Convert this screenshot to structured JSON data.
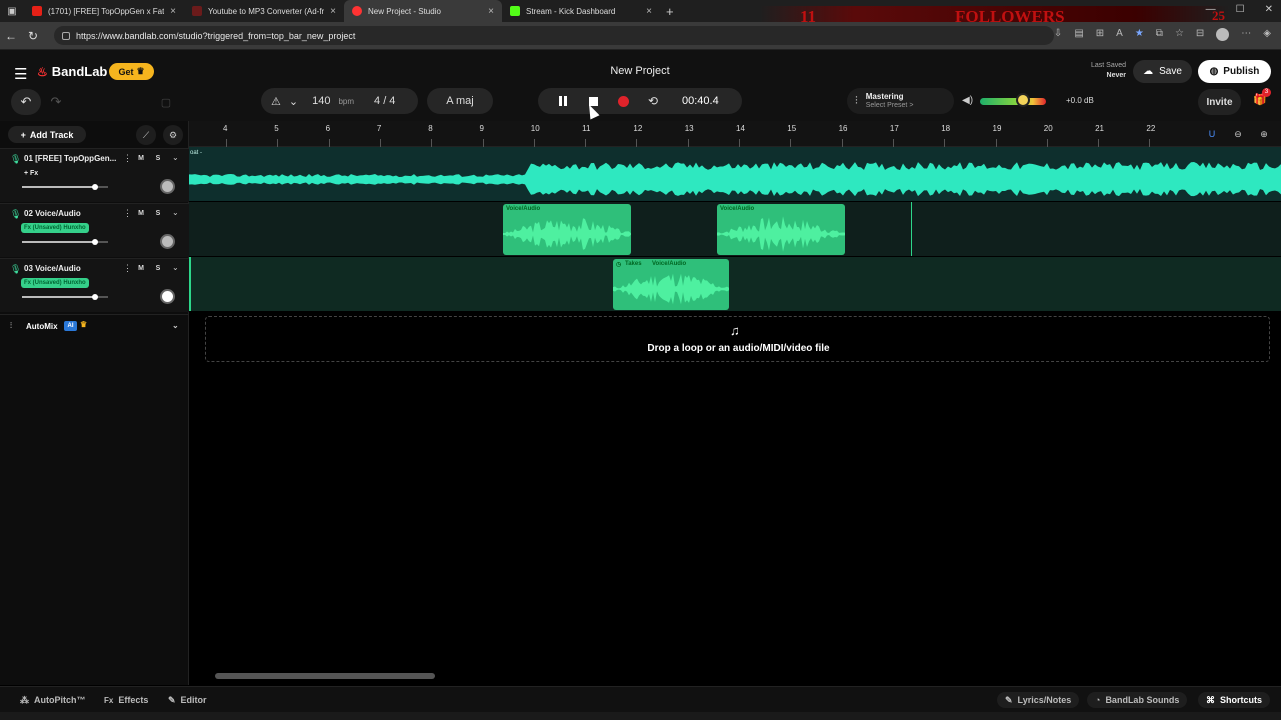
{
  "browser": {
    "tabs": [
      {
        "title": "(1701) [FREE] TopOppGen x Fatt!",
        "color": "#e62117",
        "active": false
      },
      {
        "title": "Youtube to MP3 Converter (Ad-fr",
        "color": "#cc3333",
        "active": false
      },
      {
        "title": "New Project - Studio",
        "color": "#f33",
        "active": true
      },
      {
        "title": "Stream - Kick Dashboard",
        "color": "#53fc18",
        "active": false
      }
    ],
    "url": "https://www.bandlab.com/studio?triggered_from=top_bar_new_project",
    "overlay": {
      "count_left": "11",
      "label": "FOLLOWERS",
      "count_right": "25"
    }
  },
  "header": {
    "logo": "BandLab",
    "get_label": "Get",
    "project_title": "New Project",
    "last_saved_label": "Last Saved",
    "last_saved_value": "Never",
    "save_label": "Save",
    "publish_label": "Publish",
    "invite_label": "Invite",
    "gift_badge": "3"
  },
  "transport": {
    "bpm_value": "140",
    "bpm_unit": "bpm",
    "time_signature": "4 / 4",
    "key": "A maj",
    "time": "00:40.4",
    "mastering_title": "Mastering",
    "mastering_sub": "Select Preset >",
    "volume_db": "+0.0 dB",
    "volume_level": 0.65
  },
  "left": {
    "add_track": "Add Track",
    "tracks": [
      {
        "name": "01  [FREE] TopOppGen...",
        "fx": "+ Fx",
        "fx_style": "plain",
        "volume": 0.85
      },
      {
        "name": "02  Voice/Audio",
        "fx": "Fx (Unsaved) Hunxho",
        "fx_style": "green",
        "volume": 0.85
      },
      {
        "name": "03  Voice/Audio",
        "fx": "Fx (Unsaved) Hunxho",
        "fx_style": "green",
        "volume": 0.85
      }
    ],
    "mute_label": "M",
    "solo_label": "S",
    "automix_label": "AutoMix",
    "ai_badge": "AI"
  },
  "ruler": {
    "bars": [
      "4",
      "5",
      "6",
      "7",
      "8",
      "9",
      "10",
      "11",
      "12",
      "13",
      "14",
      "15",
      "16",
      "17",
      "18",
      "19",
      "20",
      "21",
      "22"
    ]
  },
  "clips": {
    "track1_label": "oat -",
    "track2": [
      "Voice/Audio",
      "Voice/Audio"
    ],
    "track3_take": "Takes",
    "track3": "Voice/Audio"
  },
  "dropzone": {
    "text": "Drop a loop or an audio/MIDI/video file"
  },
  "bottom": {
    "autopitch": "AutoPitch™",
    "effects": "Effects",
    "editor": "Editor",
    "lyrics": "Lyrics/Notes",
    "sounds": "BandLab Sounds",
    "shortcuts": "Shortcuts"
  },
  "colors": {
    "accent": "#2dd68a",
    "wave1": "#2ee8c0",
    "wave2": "#35d08a",
    "record": "#e0232b",
    "get": "#f6b51e"
  }
}
